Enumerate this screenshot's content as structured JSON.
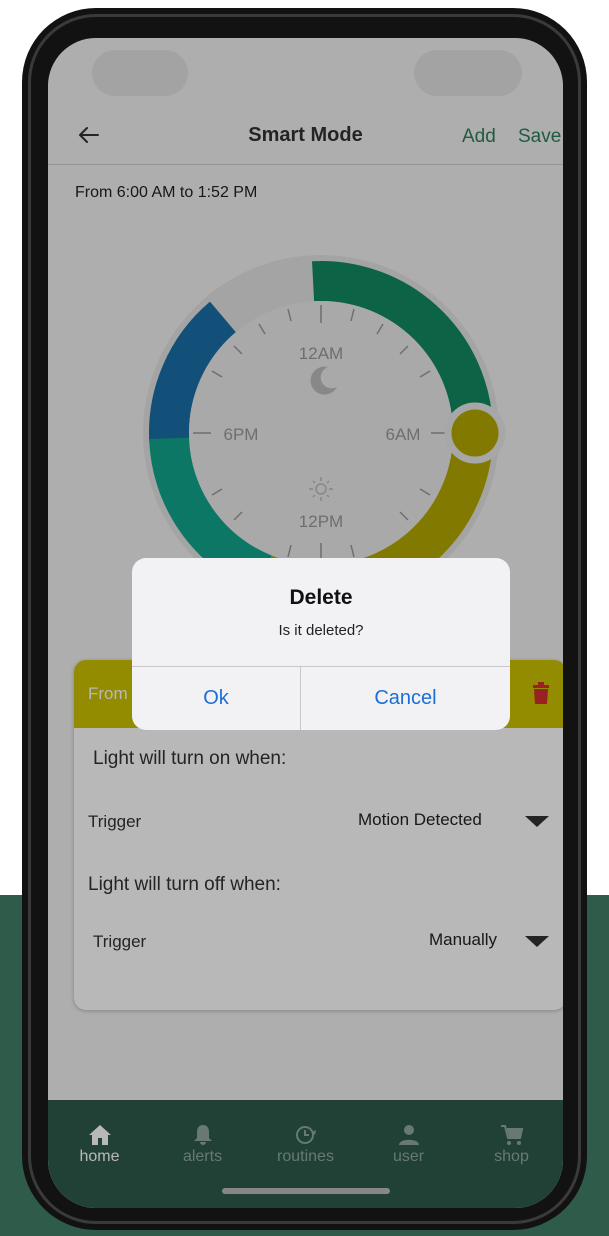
{
  "header": {
    "title": "Smart Mode",
    "add_label": "Add",
    "save_label": "Save"
  },
  "time_range": "From 6:00 AM to 1:52 PM",
  "dial": {
    "labels": {
      "top": "12AM",
      "left": "6PM",
      "right": "6AM",
      "bottom": "12PM"
    },
    "segment_colors": [
      "#1a6fa8",
      "#138a62",
      "#b5aa00",
      "#11a58c"
    ]
  },
  "card": {
    "header_color": "#ccc200",
    "from_label": "From",
    "on_heading": "Light will turn on when:",
    "on_trigger_label": "Trigger",
    "on_trigger_value": "Motion Detected",
    "off_heading": "Light will turn off when:",
    "off_trigger_label": "Trigger",
    "off_trigger_value": "Manually"
  },
  "dialog": {
    "title": "Delete",
    "message": "Is it deleted?",
    "ok_label": "Ok",
    "cancel_label": "Cancel"
  },
  "tabs": [
    {
      "label": "home",
      "icon": "home-icon",
      "active": true
    },
    {
      "label": "alerts",
      "icon": "bell-icon",
      "active": false
    },
    {
      "label": "routines",
      "icon": "clock-icon",
      "active": false
    },
    {
      "label": "user",
      "icon": "user-icon",
      "active": false
    },
    {
      "label": "shop",
      "icon": "cart-icon",
      "active": false
    }
  ],
  "colors": {
    "accent": "#2e7d5b",
    "tabbar": "#2f5b4b",
    "danger": "#d32f2f",
    "link": "#1a6fd6"
  }
}
